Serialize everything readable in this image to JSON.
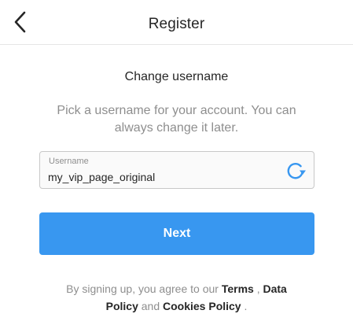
{
  "header": {
    "title": "Register",
    "back_icon": "chevron-left-icon"
  },
  "content": {
    "heading": "Change username",
    "subtext": "Pick a username for your account. You can always change it later.",
    "username_field": {
      "label": "Username",
      "value": "my_vip_page_original",
      "refresh_icon": "refresh-icon"
    },
    "next_label": "Next"
  },
  "legal": {
    "prefix": "By signing up, you agree to our",
    "terms_link": "Terms",
    "sep1": ",",
    "data_policy_link": "Data Policy",
    "and": "and",
    "cookies_link": "Cookies Policy",
    "suffix": "."
  },
  "colors": {
    "accent": "#3897f0",
    "text": "#262626",
    "muted": "#8e8e8e"
  }
}
